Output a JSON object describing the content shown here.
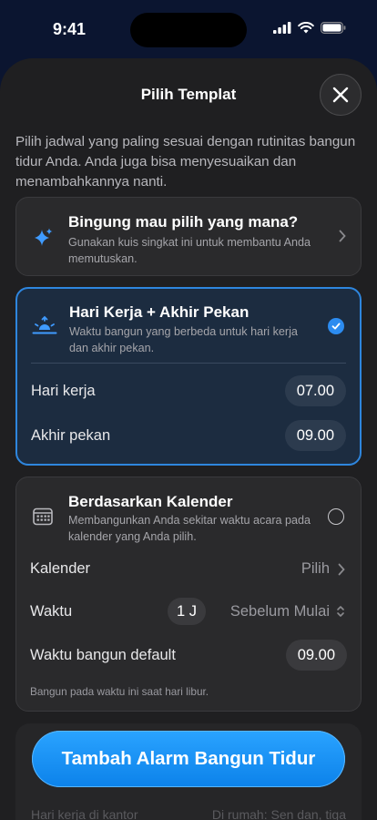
{
  "status_bar": {
    "time": "9:41"
  },
  "sheet": {
    "title": "Pilih Templat",
    "intro": "Pilih jadwal yang paling sesuai dengan rutinitas bangun tidur Anda. Anda juga bisa menyesuaikan dan menambahkannya nanti."
  },
  "quiz_card": {
    "title": "Bingung mau pilih yang mana?",
    "description": "Gunakan kuis singkat ini untuk membantu Anda memutuskan."
  },
  "weekday_card": {
    "title": "Hari Kerja + Akhir Pekan",
    "description": "Waktu bangun yang berbeda untuk hari kerja dan akhir pekan.",
    "selected": true,
    "rows": [
      {
        "label": "Hari kerja",
        "value": "07.00"
      },
      {
        "label": "Akhir pekan",
        "value": "09.00"
      }
    ]
  },
  "calendar_card": {
    "title": "Berdasarkan Kalender",
    "description": "Membangunkan Anda sekitar waktu acara pada kalender yang Anda pilih.",
    "selected": false,
    "calendar_label": "Kalender",
    "calendar_value": "Pilih",
    "time_label": "Waktu",
    "time_amount": "1 J",
    "time_relation": "Sebelum Mulai",
    "default_label": "Waktu bangun default",
    "default_value": "09.00",
    "footnote": "Bangun pada waktu ini saat hari libur."
  },
  "cta": {
    "label": "Tambah Alarm Bangun Tidur"
  },
  "behind_cta": {
    "left": "Hari kerja di kantor",
    "right": "Di rumah: Sen dan, tiga"
  },
  "colors": {
    "accent": "#2c8cf0",
    "cta": "#1796f5",
    "sheet": "#1f1f21",
    "selected_card": "#1c2c40"
  },
  "icons": {
    "quiz": "sparkles-icon",
    "weekday": "sunrise-icon",
    "calendar": "calendar-icon",
    "close": "close-icon",
    "check": "checkmark-circle-icon",
    "chevron": "chevron-right-icon",
    "updown": "chevron-updown-icon"
  }
}
